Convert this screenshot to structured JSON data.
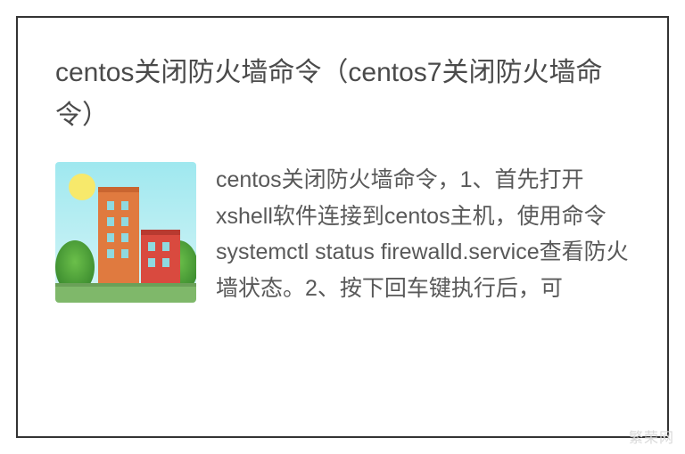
{
  "title": "centos关闭防火墙命令（centos7关闭防火墙命令）",
  "body": "centos关闭防火墙命令，1、首先打开xshell软件连接到centos主机，使用命令systemctl status firewalld.service查看防火墙状态。2、按下回车键执行后，可",
  "watermark": "繁荣网"
}
